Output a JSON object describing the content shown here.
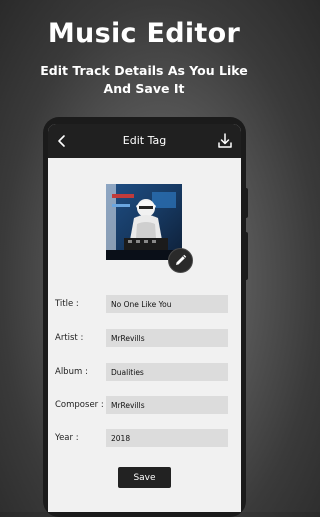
{
  "promo": {
    "title": "Music Editor",
    "subtitle_line1": "Edit Track Details As You Like",
    "subtitle_line2": "And Save It"
  },
  "appbar": {
    "title": "Edit Tag",
    "back_icon": "chevron-left-icon",
    "download_icon": "download-icon"
  },
  "cover": {
    "edit_icon": "pencil-icon"
  },
  "form": {
    "fields": [
      {
        "label": "Title :",
        "value": "No One Like You"
      },
      {
        "label": "Artist :",
        "value": "MrRevills"
      },
      {
        "label": "Album :",
        "value": "Dualities"
      },
      {
        "label": "Composer :",
        "value": "MrRevills"
      },
      {
        "label": "Year :",
        "value": "2018"
      }
    ],
    "save_label": "Save"
  },
  "colors": {
    "appbar": "#202020",
    "screen_bg": "#f1f1f1",
    "field_bg": "#dcdcdc",
    "button_bg": "#222222"
  }
}
